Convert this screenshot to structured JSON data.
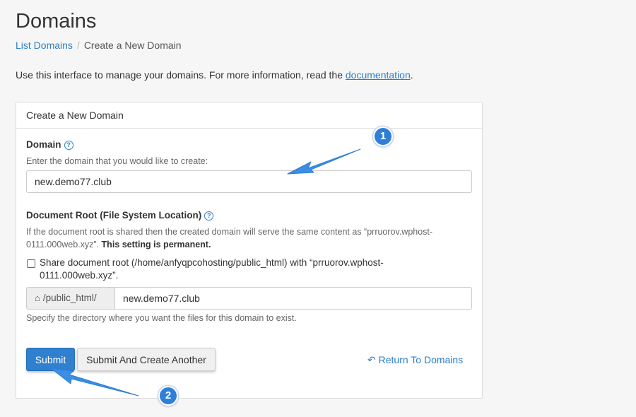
{
  "page": {
    "title": "Domains",
    "breadcrumb": {
      "parent": "List Domains",
      "current": "Create a New Domain"
    },
    "intro": {
      "text": "Use this interface to manage your domains. For more information, read the ",
      "link": "documentation",
      "end": "."
    }
  },
  "panel": {
    "heading": "Create a New Domain",
    "domain": {
      "label": "Domain",
      "hint": "Enter the domain that you would like to create:",
      "value": "new.demo77.club"
    },
    "docroot": {
      "label": "Document Root (File System Location)",
      "desc": "If the document root is shared then the created domain will serve the same content as “prruorov.wphost-0111.000web.xyz”. ",
      "desc_bold": "This setting is permanent.",
      "share_label": "Share document root (/home/anfyqpcohosting/public_html) with “prruorov.wphost-0111.000web.xyz”.",
      "share_checked": false,
      "prefix": "/public_html/",
      "value": "new.demo77.club",
      "hint": "Specify the directory where you want the files for this domain to exist."
    },
    "buttons": {
      "submit": "Submit",
      "submit_another": "Submit And Create Another",
      "return": "Return To Domains"
    }
  },
  "annotations": {
    "badge1": "1",
    "badge2": "2"
  },
  "colors": {
    "accent": "#2f80cf",
    "link": "#2a7fc8",
    "arrow": "#3b8ee6"
  },
  "icons": [
    "help-icon",
    "home-icon",
    "return-arrow-icon"
  ]
}
